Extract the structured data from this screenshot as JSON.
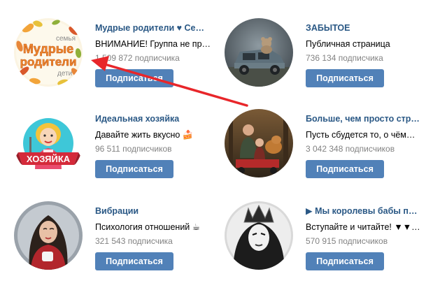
{
  "accent_color": "#5181b8",
  "name_color": "#2a5885",
  "annotation_color": "#e8262a",
  "groups": [
    {
      "name": "Мудрые родители ♥ Се…",
      "description": "ВНИМАНИЕ! Группа не пр…",
      "subscribers": "1 509 872 подписчика",
      "button": "Подписаться",
      "avatar_text": {
        "line1": "семья",
        "line2": "Мудрые",
        "line3": "родители",
        "line4": "дети"
      }
    },
    {
      "name": "ЗАБЫТОЕ",
      "description": "Публичная страница",
      "subscribers": "736 134 подписчика",
      "button": "Подписаться"
    },
    {
      "name": "Идеальная хозяйка",
      "description": "Давайте жить вкусно 🍰",
      "subscribers": "96 511 подписчиков",
      "button": "Подписаться",
      "avatar_text": {
        "line1": "ХОЗЯЙКА"
      }
    },
    {
      "name": "Больше, чем просто стр…",
      "description": "Пусть сбудется то, о чём…",
      "subscribers": "3 042 348 подписчиков",
      "button": "Подписаться"
    },
    {
      "name": "Вибрации",
      "description": "Психология отношений ☕",
      "subscribers": "321 543 подписчика",
      "button": "Подписаться"
    },
    {
      "name": "▶ Мы королевы бабы п…",
      "description": "Вступайте и читайте! ▼▼…",
      "subscribers": "570 915 подписчиков",
      "button": "Подписаться"
    }
  ]
}
